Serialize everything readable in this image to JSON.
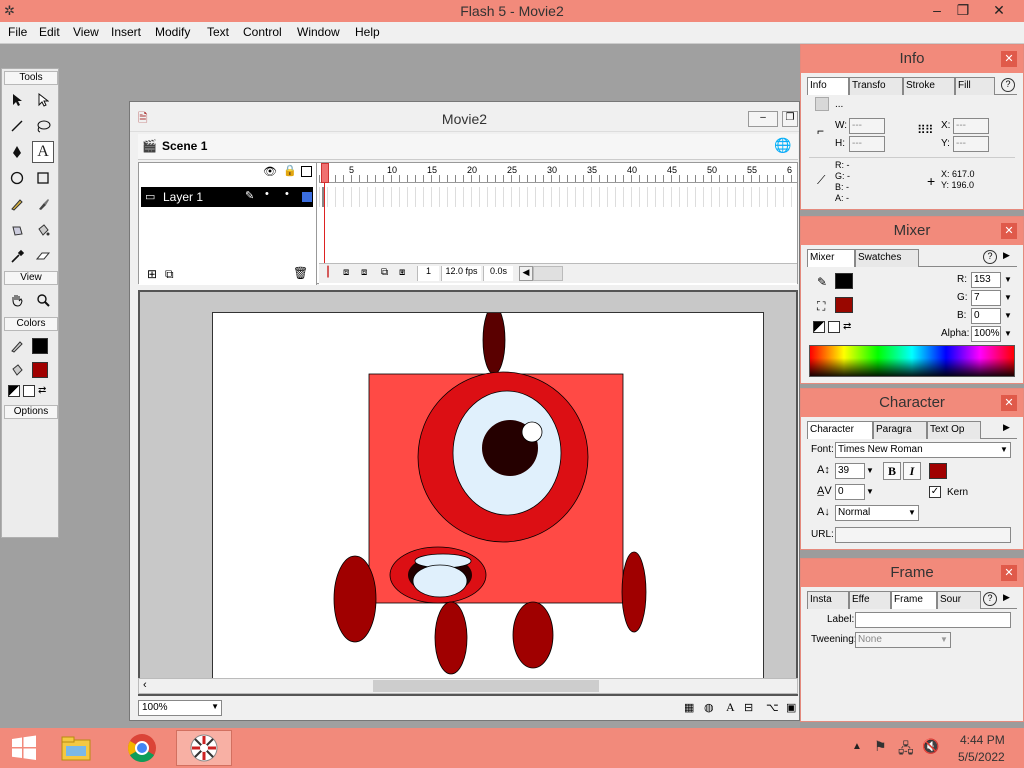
{
  "app": {
    "title": "Flash 5 - Movie2"
  },
  "window_controls": {
    "minimize": "–",
    "restore": "❐",
    "close": "✕"
  },
  "menu": [
    "File",
    "Edit",
    "View",
    "Insert",
    "Modify",
    "Text",
    "Control",
    "Window",
    "Help"
  ],
  "tools": {
    "heading": "Tools",
    "view_heading": "View",
    "colors_heading": "Colors",
    "options_heading": "Options",
    "stroke_color": "#000000",
    "fill_color": "#a00000"
  },
  "movie": {
    "title": "Movie2",
    "scene": "Scene 1",
    "layer": "Layer 1",
    "ruler": [
      "5",
      "10",
      "15",
      "20",
      "25",
      "30",
      "35",
      "40",
      "45",
      "50",
      "55",
      "6"
    ],
    "frame": "1",
    "fps": "12.0 fps",
    "time": "0.0s",
    "zoom": "100%"
  },
  "info_panel": {
    "title": "Info",
    "tabs": [
      "Info",
      "Transfo",
      "Stroke",
      "Fill"
    ],
    "dots": "...",
    "w_label": "W:",
    "w_value": "---",
    "h_label": "H:",
    "h_value": "---",
    "x_label": "X:",
    "x_value": "---",
    "y_label": "Y:",
    "y_value": "---",
    "r": "R: -",
    "g": "G: -",
    "b": "B: -",
    "a": "A: -",
    "cx": "X:   617.0",
    "cy": "Y:   196.0"
  },
  "mixer_panel": {
    "title": "Mixer",
    "tabs": [
      "Mixer",
      "Swatches"
    ],
    "r_label": "R:",
    "r": "153",
    "g_label": "G:",
    "g": "7",
    "b_label": "B:",
    "b": "0",
    "alpha_label": "Alpha:",
    "alpha": "100%",
    "stroke_color": "#000000",
    "fill_color": "#990700"
  },
  "character_panel": {
    "title": "Character",
    "tabs": [
      "Character",
      "Paragra",
      "Text Op"
    ],
    "font_label": "Font:",
    "font": "Times New Roman",
    "size": "39",
    "tracking": "0",
    "kern_label": "Kern",
    "baseline": "Normal",
    "url_label": "URL:",
    "bold": "B",
    "italic": "I",
    "text_color": "#a00000"
  },
  "frame_panel": {
    "title": "Frame",
    "tabs": [
      "Insta",
      "Effe",
      "Frame",
      "Sour"
    ],
    "label_label": "Label:",
    "tweening_label": "Tweening:",
    "tweening": "None"
  },
  "taskbar": {
    "time": "4:44 PM",
    "date": "5/5/2022"
  },
  "colors": {
    "accent": "#f28a7b",
    "body": "#ff4a45",
    "eye_outer": "#dc0f14",
    "eye_white": "#e0f0fc",
    "pupil": "#250000",
    "limb": "#a00000",
    "antenna": "#5a0000"
  }
}
